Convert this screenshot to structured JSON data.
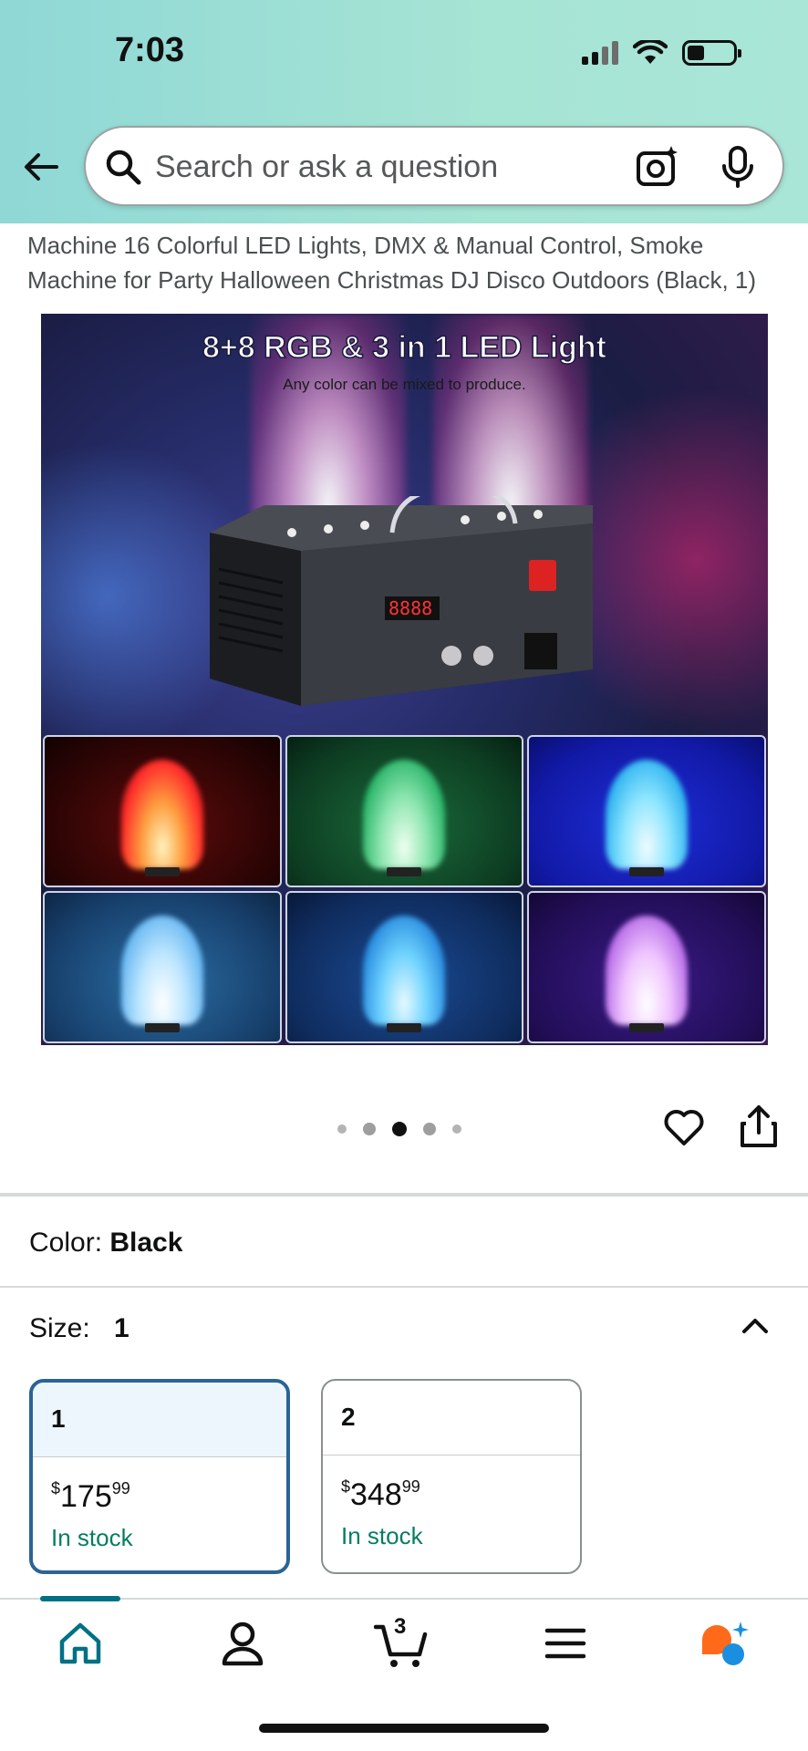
{
  "status_bar": {
    "time": "7:03"
  },
  "search": {
    "placeholder": "Search or ask a question"
  },
  "product": {
    "title": "Machine 16 Colorful LED Lights, DMX & Manual Control, Smoke Machine for Party Halloween Christmas DJ Disco Outdoors (Black, 1)",
    "image": {
      "headline": "8+8 RGB & 3 in 1 LED Light",
      "subline": "Any color can be mixed to produce."
    },
    "carousel": {
      "count": 5,
      "active_index": 2
    }
  },
  "variants": {
    "color_label": "Color:",
    "color_value": "Black",
    "size_label": "Size:",
    "size_value": "1",
    "options": [
      {
        "label": "1",
        "currency": "$",
        "whole": "175",
        "fraction": "99",
        "stock": "In stock",
        "selected": true
      },
      {
        "label": "2",
        "currency": "$",
        "whole": "348",
        "fraction": "99",
        "stock": "In stock",
        "selected": false
      }
    ]
  },
  "nav": {
    "cart_count": "3",
    "items": [
      "home-icon",
      "account-icon",
      "cart-icon",
      "menu-icon",
      "rufus-icon"
    ]
  },
  "colors": {
    "accent_teal": "#007185",
    "selected_border": "#2a6496",
    "stock_green": "#067d62"
  }
}
